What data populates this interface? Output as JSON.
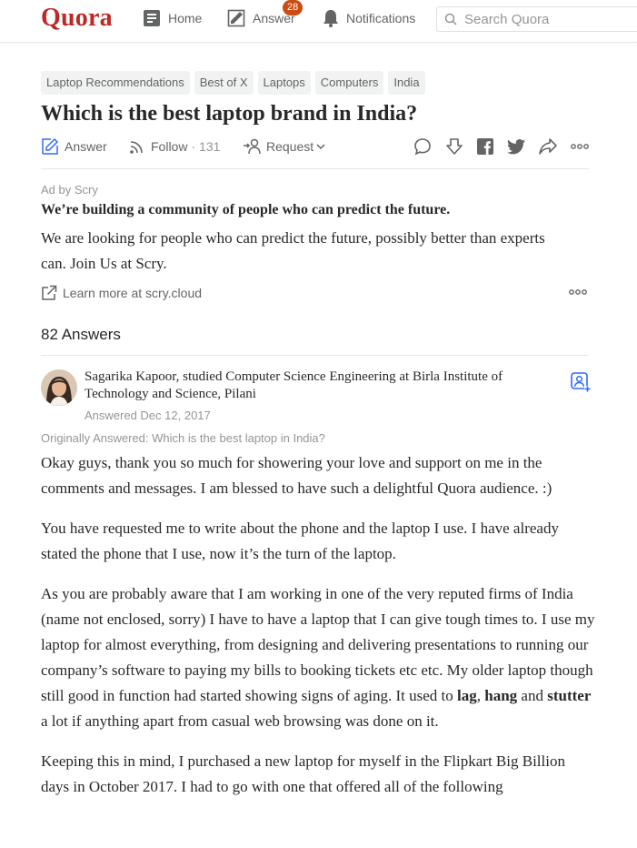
{
  "header": {
    "logo": "Quora",
    "nav": {
      "home": "Home",
      "answer": "Answer",
      "answer_badge": "28",
      "notifications": "Notifications"
    },
    "search_placeholder": "Search Quora"
  },
  "question": {
    "topics": [
      "Laptop Recommendations",
      "Best of X",
      "Laptops",
      "Computers",
      "India"
    ],
    "title": "Which is the best laptop brand in India?",
    "actions": {
      "answer": "Answer",
      "follow": "Follow",
      "follow_count": "131",
      "request": "Request"
    }
  },
  "ad": {
    "label": "Ad by Scry",
    "headline": "We’re building a community of people who can predict the future.",
    "body": "We are looking for people who can predict the future, possibly better than experts can. Join Us at Scry.",
    "link": "Learn more at scry.cloud"
  },
  "answers_count": "82 Answers",
  "answer": {
    "author": "Sagarika Kapoor, studied Computer Science Engineering at Birla Institute of Technology and Science, Pilani",
    "answered_date": "Answered Dec 12, 2017",
    "originally_answered": "Originally Answered: Which is the best laptop in India?",
    "paragraphs": [
      "Okay guys, thank you so much for showering your love and support on me in the comments and messages. I am blessed to have such a delightful Quora audience. :)",
      "You have requested me to write about the phone and the laptop I use. I have already stated the phone that I use, now it’s the turn of the laptop."
    ],
    "p3": {
      "before": "As you are probably aware that I am working in one of the very reputed firms of India (name not enclosed, sorry) I have to have a laptop that I can give tough times to. I use my laptop for almost everything, from designing and delivering presentations to running our company’s software to paying my bills to booking tickets etc etc. My older laptop though still good in function had started showing signs of aging. It used to ",
      "bold1": "lag",
      "sep1": ", ",
      "bold2": "hang",
      "sep2": " and ",
      "bold3": "stutter",
      "after": " a lot if anything apart from casual web browsing was done on it."
    },
    "p4": "Keeping this in mind, I purchased a new laptop for myself in the Flipkart Big Billion days in October 2017. I had to go with one that offered all of the following"
  }
}
